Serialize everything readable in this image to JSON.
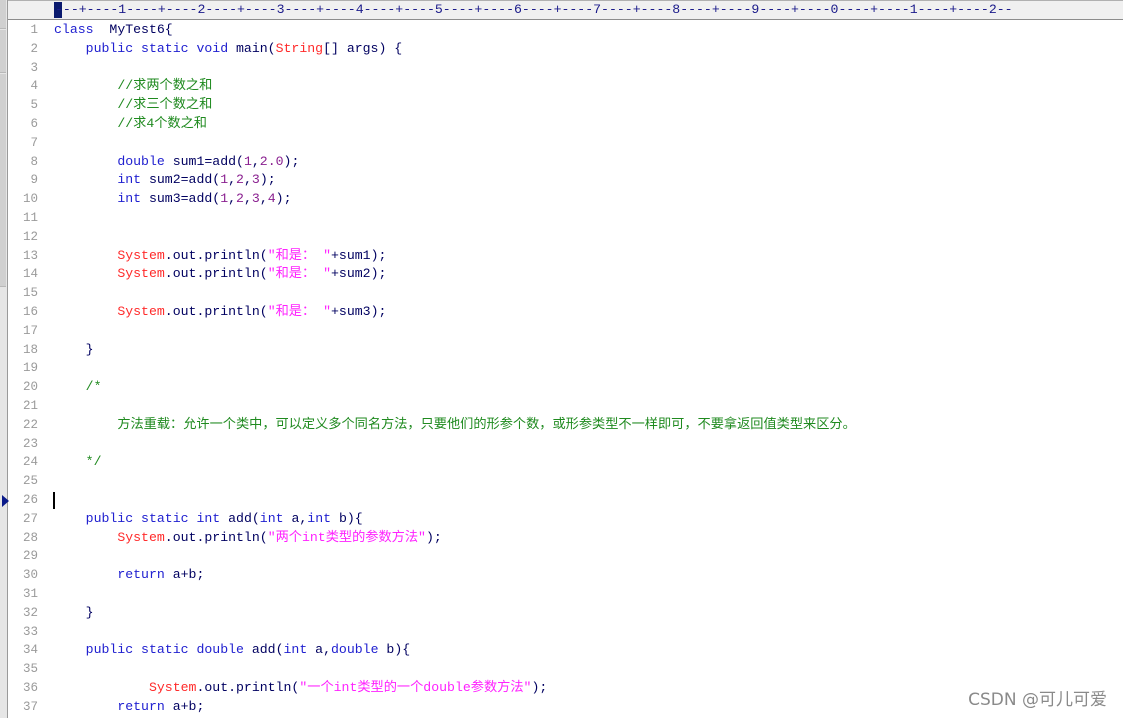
{
  "ruler": {
    "text": "---+----1----+----2----+----3----+----4----+----5----+----6----+----7----+----8----+----9----+----0----+----1----+----2--"
  },
  "editor": {
    "current_line": 26,
    "lines": [
      {
        "n": "1",
        "tokens": [
          [
            "kw",
            "class"
          ],
          [
            "plain",
            "  MyTest6{"
          ]
        ]
      },
      {
        "n": "2",
        "tokens": [
          [
            "plain",
            "    "
          ],
          [
            "kw",
            "public static void"
          ],
          [
            "plain",
            " main("
          ],
          [
            "cls",
            "String"
          ],
          [
            "plain",
            "[] args) {"
          ]
        ]
      },
      {
        "n": "3",
        "tokens": []
      },
      {
        "n": "4",
        "tokens": [
          [
            "plain",
            "        "
          ],
          [
            "cmt",
            "//求两个数之和"
          ]
        ]
      },
      {
        "n": "5",
        "tokens": [
          [
            "plain",
            "        "
          ],
          [
            "cmt",
            "//求三个数之和"
          ]
        ]
      },
      {
        "n": "6",
        "tokens": [
          [
            "plain",
            "        "
          ],
          [
            "cmt",
            "//求4个数之和"
          ]
        ]
      },
      {
        "n": "7",
        "tokens": []
      },
      {
        "n": "8",
        "tokens": [
          [
            "plain",
            "        "
          ],
          [
            "kw",
            "double"
          ],
          [
            "plain",
            " sum1=add("
          ],
          [
            "num",
            "1"
          ],
          [
            "plain",
            ","
          ],
          [
            "num",
            "2.0"
          ],
          [
            "plain",
            ");"
          ]
        ]
      },
      {
        "n": "9",
        "tokens": [
          [
            "plain",
            "        "
          ],
          [
            "kw",
            "int"
          ],
          [
            "plain",
            " sum2=add("
          ],
          [
            "num",
            "1"
          ],
          [
            "plain",
            ","
          ],
          [
            "num",
            "2"
          ],
          [
            "plain",
            ","
          ],
          [
            "num",
            "3"
          ],
          [
            "plain",
            ");"
          ]
        ]
      },
      {
        "n": "10",
        "tokens": [
          [
            "plain",
            "        "
          ],
          [
            "kw",
            "int"
          ],
          [
            "plain",
            " sum3=add("
          ],
          [
            "num",
            "1"
          ],
          [
            "plain",
            ","
          ],
          [
            "num",
            "2"
          ],
          [
            "plain",
            ","
          ],
          [
            "num",
            "3"
          ],
          [
            "plain",
            ","
          ],
          [
            "num",
            "4"
          ],
          [
            "plain",
            ");"
          ]
        ]
      },
      {
        "n": "11",
        "tokens": []
      },
      {
        "n": "12",
        "tokens": []
      },
      {
        "n": "13",
        "tokens": [
          [
            "plain",
            "        "
          ],
          [
            "cls",
            "System"
          ],
          [
            "plain",
            ".out.println("
          ],
          [
            "str",
            "\"和是： \""
          ],
          [
            "plain",
            "+sum1);"
          ]
        ]
      },
      {
        "n": "14",
        "tokens": [
          [
            "plain",
            "        "
          ],
          [
            "cls",
            "System"
          ],
          [
            "plain",
            ".out.println("
          ],
          [
            "str",
            "\"和是： \""
          ],
          [
            "plain",
            "+sum2);"
          ]
        ]
      },
      {
        "n": "15",
        "tokens": []
      },
      {
        "n": "16",
        "tokens": [
          [
            "plain",
            "        "
          ],
          [
            "cls",
            "System"
          ],
          [
            "plain",
            ".out.println("
          ],
          [
            "str",
            "\"和是： \""
          ],
          [
            "plain",
            "+sum3);"
          ]
        ]
      },
      {
        "n": "17",
        "tokens": []
      },
      {
        "n": "18",
        "tokens": [
          [
            "plain",
            "    }"
          ]
        ]
      },
      {
        "n": "19",
        "tokens": []
      },
      {
        "n": "20",
        "tokens": [
          [
            "plain",
            "    "
          ],
          [
            "cmt",
            "/*"
          ]
        ]
      },
      {
        "n": "21",
        "tokens": []
      },
      {
        "n": "22",
        "tokens": [
          [
            "plain",
            "        "
          ],
          [
            "cmt",
            "方法重载：允许一个类中，可以定义多个同名方法，只要他们的形参个数，或形参类型不一样即可，不要拿返回值类型来区分。"
          ]
        ]
      },
      {
        "n": "23",
        "tokens": []
      },
      {
        "n": "24",
        "tokens": [
          [
            "plain",
            "    "
          ],
          [
            "cmt",
            "*/"
          ]
        ]
      },
      {
        "n": "25",
        "tokens": []
      },
      {
        "n": "26",
        "tokens": []
      },
      {
        "n": "27",
        "tokens": [
          [
            "plain",
            "    "
          ],
          [
            "kw",
            "public static int"
          ],
          [
            "plain",
            " add("
          ],
          [
            "kw",
            "int"
          ],
          [
            "plain",
            " a,"
          ],
          [
            "kw",
            "int"
          ],
          [
            "plain",
            " b){"
          ]
        ]
      },
      {
        "n": "28",
        "tokens": [
          [
            "plain",
            "        "
          ],
          [
            "cls",
            "System"
          ],
          [
            "plain",
            ".out.println("
          ],
          [
            "str",
            "\"两个int类型的参数方法\""
          ],
          [
            "plain",
            ");"
          ]
        ]
      },
      {
        "n": "29",
        "tokens": []
      },
      {
        "n": "30",
        "tokens": [
          [
            "plain",
            "        "
          ],
          [
            "kw",
            "return"
          ],
          [
            "plain",
            " a+b;"
          ]
        ]
      },
      {
        "n": "31",
        "tokens": []
      },
      {
        "n": "32",
        "tokens": [
          [
            "plain",
            "    }"
          ]
        ]
      },
      {
        "n": "33",
        "tokens": []
      },
      {
        "n": "34",
        "tokens": [
          [
            "plain",
            "    "
          ],
          [
            "kw",
            "public static double"
          ],
          [
            "plain",
            " add("
          ],
          [
            "kw",
            "int"
          ],
          [
            "plain",
            " a,"
          ],
          [
            "kw",
            "double"
          ],
          [
            "plain",
            " b){"
          ]
        ]
      },
      {
        "n": "35",
        "tokens": []
      },
      {
        "n": "36",
        "tokens": [
          [
            "plain",
            "            "
          ],
          [
            "cls",
            "System"
          ],
          [
            "plain",
            ".out.println("
          ],
          [
            "str",
            "\"一个int类型的一个double参数方法\""
          ],
          [
            "plain",
            ");"
          ]
        ]
      },
      {
        "n": "37",
        "tokens": [
          [
            "plain",
            "        "
          ],
          [
            "kw",
            "return"
          ],
          [
            "plain",
            " a+b;"
          ]
        ]
      }
    ]
  },
  "watermark": "CSDN @可儿可爱"
}
